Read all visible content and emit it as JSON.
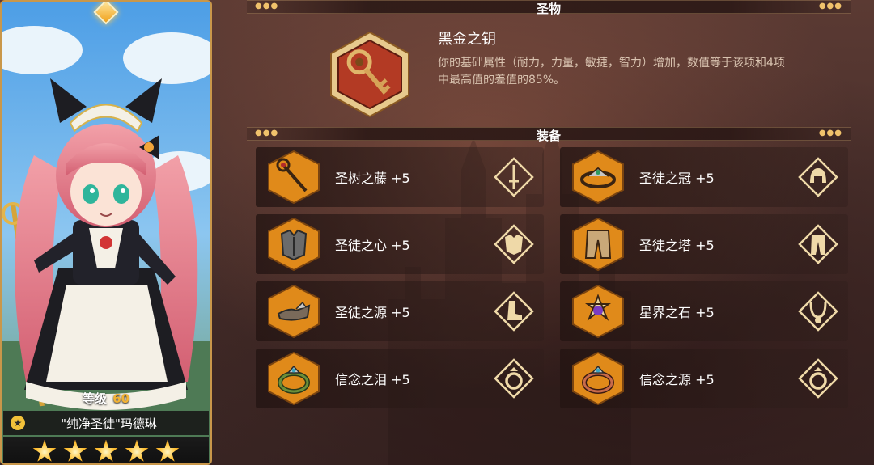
{
  "character": {
    "level_label": "等级",
    "level_value": "60",
    "name": "\"纯净圣徒\"玛德琳",
    "star_count": 5
  },
  "relic": {
    "section_title": "圣物",
    "name": "黑金之钥",
    "description": "你的基础属性（耐力，力量，敏捷，智力）增加，数值等于该项和4项中最高值的差值的85%。",
    "icon": "key-icon"
  },
  "equipment": {
    "section_title": "装备",
    "items": [
      {
        "name": "圣树之藤 +5",
        "icon": "staff-icon",
        "slot_icon": "weapon-slot-icon"
      },
      {
        "name": "圣徒之冠 +5",
        "icon": "circlet-icon",
        "slot_icon": "helmet-slot-icon"
      },
      {
        "name": "圣徒之心 +5",
        "icon": "armor-icon",
        "slot_icon": "chest-slot-icon"
      },
      {
        "name": "圣徒之塔 +5",
        "icon": "pants-icon",
        "slot_icon": "legs-slot-icon"
      },
      {
        "name": "圣徒之源 +5",
        "icon": "shoes-icon",
        "slot_icon": "boots-slot-icon"
      },
      {
        "name": "星界之石 +5",
        "icon": "star-gem-icon",
        "slot_icon": "necklace-slot-icon"
      },
      {
        "name": "信念之泪 +5",
        "icon": "ring-icon",
        "slot_icon": "ring-slot-icon"
      },
      {
        "name": "信念之源 +5",
        "icon": "ring-icon",
        "slot_icon": "ring-slot-icon"
      }
    ]
  },
  "colors": {
    "gold": "#c9974a",
    "icon_orange": "#e08a1a",
    "level_value": "#f3b334"
  }
}
